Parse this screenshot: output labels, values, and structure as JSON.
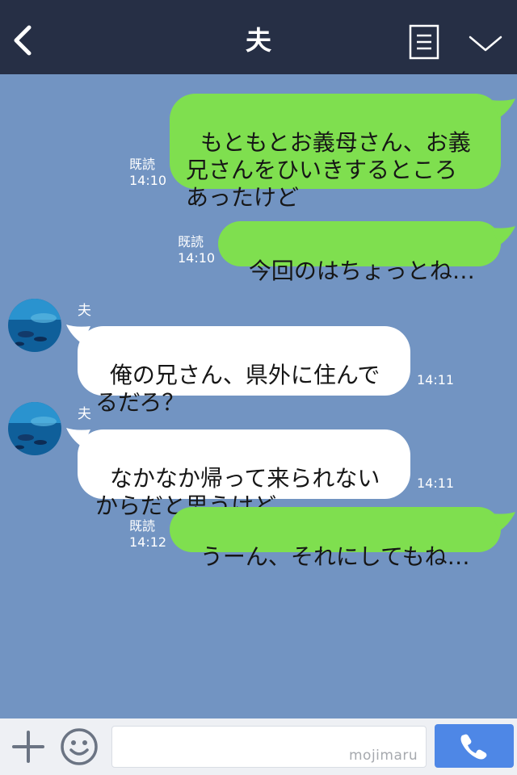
{
  "header": {
    "title": "夫"
  },
  "messages": [
    {
      "side": "me",
      "text": "もともとお義母さん、お義\n兄さんをひいきするところ\nあったけど",
      "read": "既読",
      "time": "14:10"
    },
    {
      "side": "me",
      "text": "今回のはちょっとね…",
      "read": "既読",
      "time": "14:10"
    },
    {
      "side": "them",
      "sender": "夫",
      "text": "俺の兄さん、県外に住んで\nるだろ？",
      "time": "14:11"
    },
    {
      "side": "them",
      "sender": "夫",
      "text": "なかなか帰って来られない\nからだと思うけど",
      "time": "14:11"
    },
    {
      "side": "me",
      "text": "うーん、それにしてもね…",
      "read": "既読",
      "time": "14:12"
    }
  ],
  "input": {
    "value": "",
    "placeholder": ""
  },
  "watermark": "mojimaru",
  "icons": {
    "back": "chevron-left-icon",
    "menu": "menu-list-icon",
    "collapse": "chevron-down-icon",
    "add": "plus-icon",
    "emoji": "smiley-icon",
    "call": "phone-icon"
  },
  "colors": {
    "header_bg": "#262f45",
    "chat_bg": "#7294c2",
    "my_bubble": "#7fdf4f",
    "their_bubble": "#ffffff",
    "call_button": "#4e87e6"
  }
}
